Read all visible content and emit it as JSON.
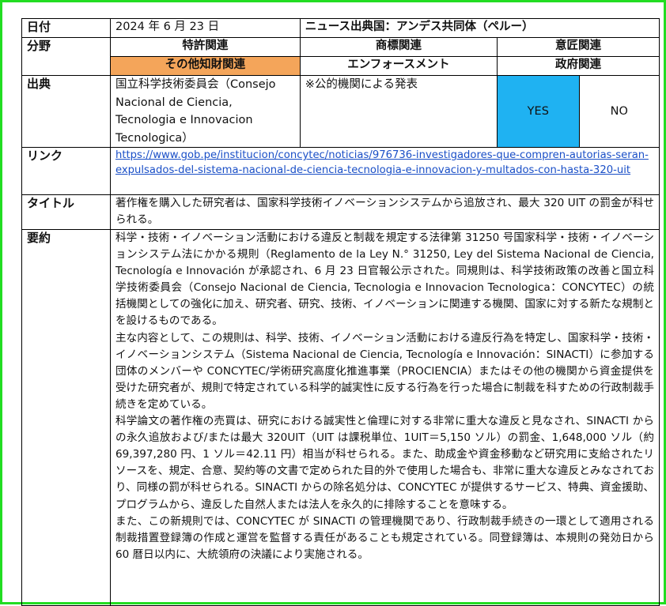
{
  "labels": {
    "date": "日付",
    "field": "分野",
    "source": "出典",
    "link": "リンク",
    "title": "タイトル",
    "summary": "要約"
  },
  "date_value": "2024 年 6 月 23 日",
  "news_origin": "ニュース出典国：アンデス共同体（ペルー）",
  "categories": {
    "patent": "特許関連",
    "trademark": "商標関連",
    "design": "意匠関連",
    "other_ip": "その他知財関連",
    "enforcement": "エンフォースメント",
    "government": "政府関連"
  },
  "source_text": "国立科学技術委員会（Consejo Nacional de Ciencia, Tecnologia e Innovacion Tecnologica）",
  "public_note": "※公的機関による発表",
  "yes_label": "YES",
  "no_label": "NO",
  "link_url": "https://www.gob.pe/institucion/concytec/noticias/976736-investigadores-que-compren-autorias-seran-expulsados-del-sistema-nacional-de-ciencia-tecnologia-e-innovacion-y-multados-con-hasta-320-uit",
  "title_text": "著作権を購入した研究者は、国家科学技術イノベーションシステムから追放され、最大 320 UIT の罰金が科せられる。",
  "summary_paragraphs": [
    "科学・技術・イノベーション活動における違反と制裁を規定する法律第 31250 号国家科学・技術・イノベーションシステム法にかかる規則（Reglamento de la Ley N.° 31250, Ley del Sistema Nacional de Ciencia, Tecnología e Innovación が承認され、6 月 23 日官報公示された。同規則は、科学技術政策の改善と国立科学技術委員会（Consejo Nacional de Ciencia, Tecnologia e Innovacion Tecnologica：CONCYTEC）の統括機関としての強化に加え、研究者、研究、技術、イノベーションに関連する機関、国家に対する新たな規制とを設けるものである。",
    "主な内容として、この規則は、科学、技術、イノベーション活動における違反行為を特定し、国家科学・技術・イノベーションシステム（Sistema Nacional de Ciencia, Tecnología e Innovación：SINACTI）に参加する団体のメンバーや CONCYTEC/学術研究高度化推進事業（PROCIENCIA）またはその他の機関から資金提供を受けた研究者が、規則で特定されている科学的誠実性に反する行為を行った場合に制裁を科すための行政制裁手続きを定めている。",
    "科学論文の著作権の売買は、研究における誠実性と倫理に対する非常に重大な違反と見なされ、SINACTI からの永久追放および/または最大 320UIT（UIT は課税単位、1UIT＝5,150 ソル）の罰金、1,648,000 ソル（約 69,397,280 円、1 ソル＝42.11 円）相当が科せられる。また、助成金や資金移動など研究用に支給されたリソースを、規定、合意、契約等の文書で定められた目的外で使用した場合も、非常に重大な違反とみなされており、同様の罰が科せられる。SINACTI からの除名処分は、CONCYTEC が提供するサービス、特典、資金援助、プログラムから、違反した自然人または法人を永久的に排除することを意味する。",
    "また、この新規則では、CONCYTEC が SINACTI の管理機関であり、行政制裁手続きの一環として適用される制裁措置登録簿の作成と運営を監督する責任があることも規定されている。同登録簿は、本規則の発効日から 60 暦日以内に、大統領府の決議により実施される。"
  ]
}
